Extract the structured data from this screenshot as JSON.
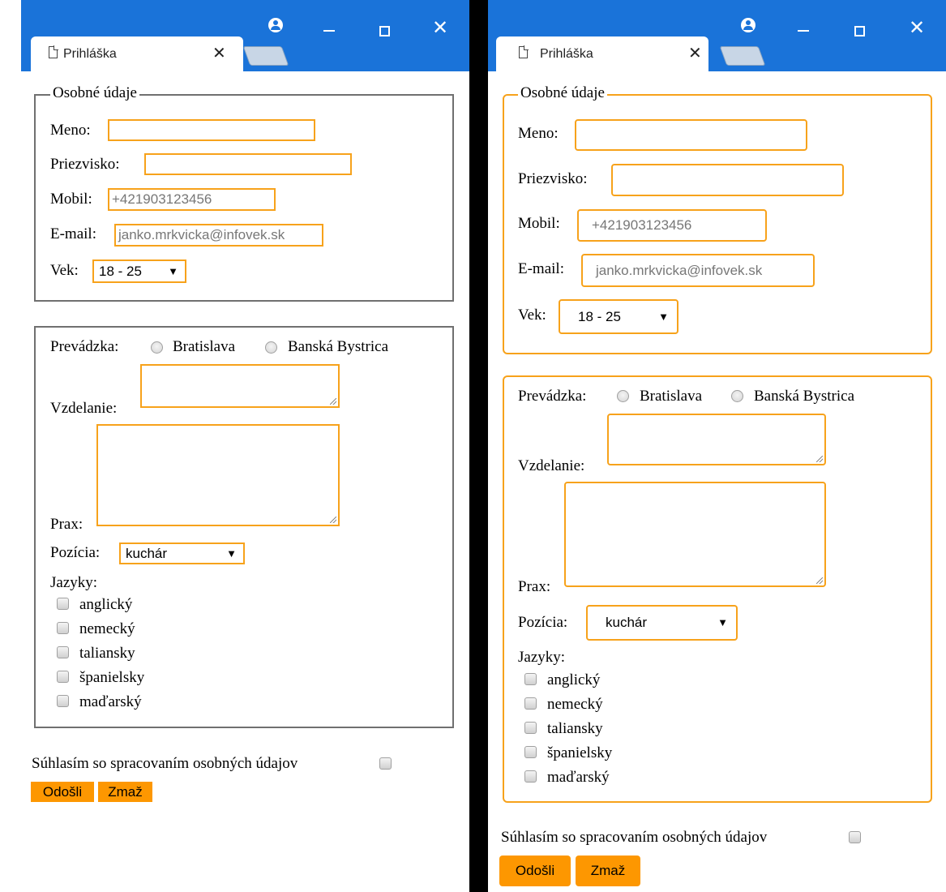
{
  "browser": {
    "tab_title": "Prihláška",
    "tab_close": "✕",
    "window_minimize": "—",
    "window_maximize": "☐",
    "window_close": "✕"
  },
  "form": {
    "personal_legend": "Osobné údaje",
    "name_label": "Meno:",
    "name_value": "",
    "surname_label": "Priezvisko:",
    "surname_value": "",
    "mobile_label": "Mobil:",
    "mobile_placeholder": "+421903123456",
    "email_label": "E-mail:",
    "email_placeholder": "janko.mrkvicka@infovek.sk",
    "age_label": "Vek:",
    "age_selected": "18 - 25",
    "branch_label": "Prevádzka:",
    "branch_options": [
      "Bratislava",
      "Banská Bystrica"
    ],
    "education_label": "Vzdelanie:",
    "practice_label": "Prax:",
    "position_label": "Pozícia:",
    "position_selected": "kuchár",
    "languages_label": "Jazyky:",
    "languages": [
      "anglický",
      "nemecký",
      "taliansky",
      "španielsky",
      "maďarský"
    ],
    "consent_label": "Súhlasím so spracovaním osobných údajov",
    "submit_label": "Odošli",
    "reset_label": "Zmaž"
  },
  "colors": {
    "titlebar": "#1a73d9",
    "accent": "#f7a21b",
    "button": "#fd9701"
  }
}
